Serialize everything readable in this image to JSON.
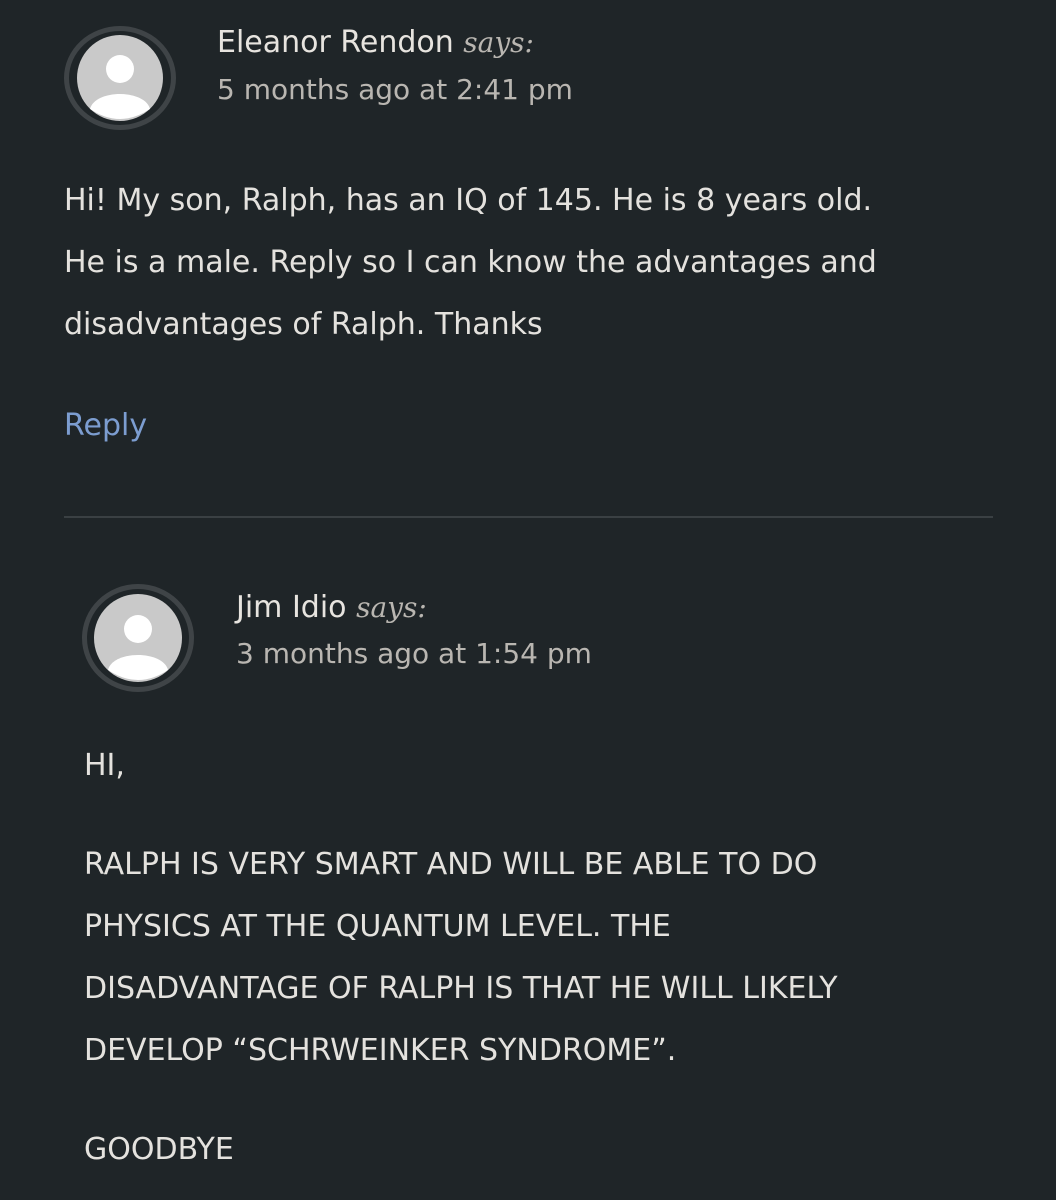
{
  "comments": [
    {
      "author": "Eleanor Rendon",
      "says": "says:",
      "timestamp": "5 months ago at 2:41 pm",
      "body_lines": [
        "Hi! My son, Ralph, has an IQ of 145. He is 8 years old.",
        "He is a male. Reply so I can know the advantages and",
        "disadvantages of Ralph. Thanks"
      ],
      "reply_label": "Reply"
    },
    {
      "author": "Jim Idio",
      "says": "says:",
      "timestamp": "3 months ago at 1:54 pm",
      "greeting": "HI,",
      "body_lines": [
        "RALPH IS VERY SMART AND WILL BE ABLE TO DO",
        "PHYSICS AT THE QUANTUM LEVEL. THE",
        "DISADVANTAGE OF RALPH IS THAT HE WILL LIKELY",
        "DEVELOP “SCHRWEINKER SYNDROME”."
      ],
      "signoff": "GOODBYE"
    }
  ],
  "colors": {
    "background": "#1f2528",
    "text": "#e4e2de",
    "muted": "#b9b6b1",
    "link": "#7c9dd0",
    "divider": "#3a4043"
  },
  "icons": {
    "avatar": "default-user-avatar-icon"
  }
}
